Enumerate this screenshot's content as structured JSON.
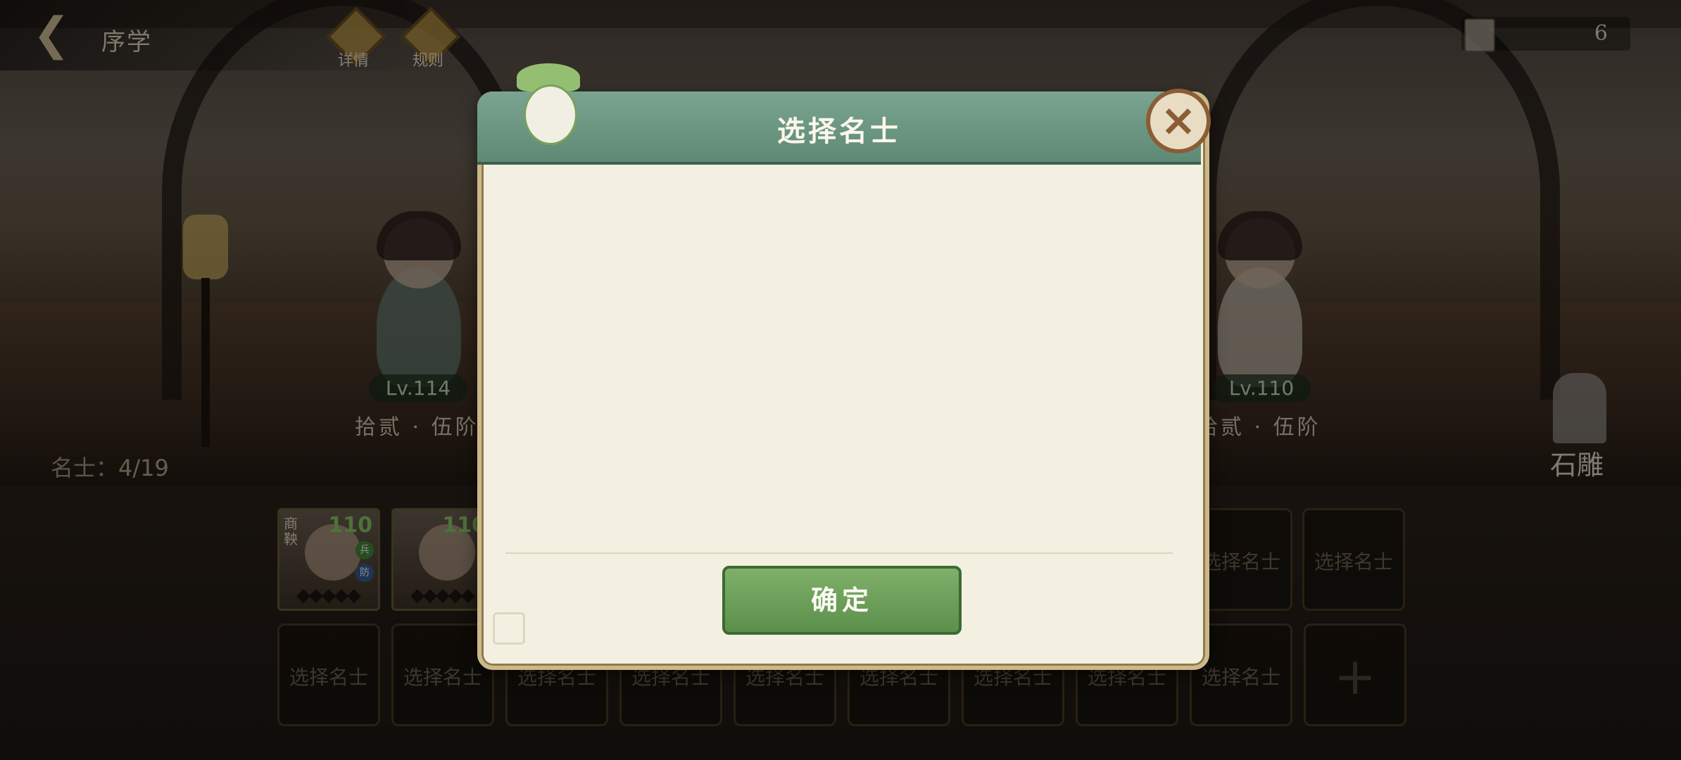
{
  "header": {
    "back_icon": "chevron-left-icon",
    "title": "序学",
    "detail_label": "详情",
    "rules_label": "规则",
    "currency_value": "6"
  },
  "stage": {
    "left_hero": {
      "level": "Lv.114",
      "rank": "拾贰 · 伍阶"
    },
    "right_hero": {
      "level": "Lv.110",
      "rank": "拾贰 · 伍阶"
    },
    "count_label": "名士：",
    "count_value": "4/19",
    "statue_label": "石雕"
  },
  "roster": {
    "cards": [
      {
        "name": "商鞅",
        "level": "110",
        "badge_top": "兵",
        "badge_bottom": "防"
      },
      {
        "name": "",
        "level": "110",
        "badge_top": "",
        "badge_bottom": ""
      }
    ],
    "empty_slot_label": "选择名士",
    "add_symbol": "+"
  },
  "dialog": {
    "title": "选择名士",
    "confirm_label": "确定",
    "close_icon": "close-icon"
  },
  "colors": {
    "dialog_header": "#6f9a84",
    "confirm_button": "#6c9f58",
    "close_ring": "#8a5d35",
    "paper": "#f4f0e1"
  }
}
